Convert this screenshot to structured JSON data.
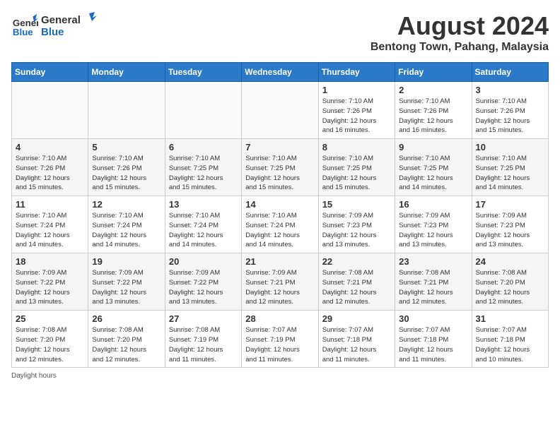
{
  "header": {
    "logo_general": "General",
    "logo_blue": "Blue",
    "title": "August 2024",
    "subtitle": "Bentong Town, Pahang, Malaysia"
  },
  "calendar": {
    "days_of_week": [
      "Sunday",
      "Monday",
      "Tuesday",
      "Wednesday",
      "Thursday",
      "Friday",
      "Saturday"
    ],
    "weeks": [
      [
        {
          "day": "",
          "info": ""
        },
        {
          "day": "",
          "info": ""
        },
        {
          "day": "",
          "info": ""
        },
        {
          "day": "",
          "info": ""
        },
        {
          "day": "1",
          "info": "Sunrise: 7:10 AM\nSunset: 7:26 PM\nDaylight: 12 hours\nand 16 minutes."
        },
        {
          "day": "2",
          "info": "Sunrise: 7:10 AM\nSunset: 7:26 PM\nDaylight: 12 hours\nand 16 minutes."
        },
        {
          "day": "3",
          "info": "Sunrise: 7:10 AM\nSunset: 7:26 PM\nDaylight: 12 hours\nand 15 minutes."
        }
      ],
      [
        {
          "day": "4",
          "info": "Sunrise: 7:10 AM\nSunset: 7:26 PM\nDaylight: 12 hours\nand 15 minutes."
        },
        {
          "day": "5",
          "info": "Sunrise: 7:10 AM\nSunset: 7:26 PM\nDaylight: 12 hours\nand 15 minutes."
        },
        {
          "day": "6",
          "info": "Sunrise: 7:10 AM\nSunset: 7:25 PM\nDaylight: 12 hours\nand 15 minutes."
        },
        {
          "day": "7",
          "info": "Sunrise: 7:10 AM\nSunset: 7:25 PM\nDaylight: 12 hours\nand 15 minutes."
        },
        {
          "day": "8",
          "info": "Sunrise: 7:10 AM\nSunset: 7:25 PM\nDaylight: 12 hours\nand 15 minutes."
        },
        {
          "day": "9",
          "info": "Sunrise: 7:10 AM\nSunset: 7:25 PM\nDaylight: 12 hours\nand 14 minutes."
        },
        {
          "day": "10",
          "info": "Sunrise: 7:10 AM\nSunset: 7:25 PM\nDaylight: 12 hours\nand 14 minutes."
        }
      ],
      [
        {
          "day": "11",
          "info": "Sunrise: 7:10 AM\nSunset: 7:24 PM\nDaylight: 12 hours\nand 14 minutes."
        },
        {
          "day": "12",
          "info": "Sunrise: 7:10 AM\nSunset: 7:24 PM\nDaylight: 12 hours\nand 14 minutes."
        },
        {
          "day": "13",
          "info": "Sunrise: 7:10 AM\nSunset: 7:24 PM\nDaylight: 12 hours\nand 14 minutes."
        },
        {
          "day": "14",
          "info": "Sunrise: 7:10 AM\nSunset: 7:24 PM\nDaylight: 12 hours\nand 14 minutes."
        },
        {
          "day": "15",
          "info": "Sunrise: 7:09 AM\nSunset: 7:23 PM\nDaylight: 12 hours\nand 13 minutes."
        },
        {
          "day": "16",
          "info": "Sunrise: 7:09 AM\nSunset: 7:23 PM\nDaylight: 12 hours\nand 13 minutes."
        },
        {
          "day": "17",
          "info": "Sunrise: 7:09 AM\nSunset: 7:23 PM\nDaylight: 12 hours\nand 13 minutes."
        }
      ],
      [
        {
          "day": "18",
          "info": "Sunrise: 7:09 AM\nSunset: 7:22 PM\nDaylight: 12 hours\nand 13 minutes."
        },
        {
          "day": "19",
          "info": "Sunrise: 7:09 AM\nSunset: 7:22 PM\nDaylight: 12 hours\nand 13 minutes."
        },
        {
          "day": "20",
          "info": "Sunrise: 7:09 AM\nSunset: 7:22 PM\nDaylight: 12 hours\nand 13 minutes."
        },
        {
          "day": "21",
          "info": "Sunrise: 7:09 AM\nSunset: 7:21 PM\nDaylight: 12 hours\nand 12 minutes."
        },
        {
          "day": "22",
          "info": "Sunrise: 7:08 AM\nSunset: 7:21 PM\nDaylight: 12 hours\nand 12 minutes."
        },
        {
          "day": "23",
          "info": "Sunrise: 7:08 AM\nSunset: 7:21 PM\nDaylight: 12 hours\nand 12 minutes."
        },
        {
          "day": "24",
          "info": "Sunrise: 7:08 AM\nSunset: 7:20 PM\nDaylight: 12 hours\nand 12 minutes."
        }
      ],
      [
        {
          "day": "25",
          "info": "Sunrise: 7:08 AM\nSunset: 7:20 PM\nDaylight: 12 hours\nand 12 minutes."
        },
        {
          "day": "26",
          "info": "Sunrise: 7:08 AM\nSunset: 7:20 PM\nDaylight: 12 hours\nand 12 minutes."
        },
        {
          "day": "27",
          "info": "Sunrise: 7:08 AM\nSunset: 7:19 PM\nDaylight: 12 hours\nand 11 minutes."
        },
        {
          "day": "28",
          "info": "Sunrise: 7:07 AM\nSunset: 7:19 PM\nDaylight: 12 hours\nand 11 minutes."
        },
        {
          "day": "29",
          "info": "Sunrise: 7:07 AM\nSunset: 7:18 PM\nDaylight: 12 hours\nand 11 minutes."
        },
        {
          "day": "30",
          "info": "Sunrise: 7:07 AM\nSunset: 7:18 PM\nDaylight: 12 hours\nand 11 minutes."
        },
        {
          "day": "31",
          "info": "Sunrise: 7:07 AM\nSunset: 7:18 PM\nDaylight: 12 hours\nand 10 minutes."
        }
      ]
    ]
  },
  "footer": {
    "note": "Daylight hours"
  }
}
